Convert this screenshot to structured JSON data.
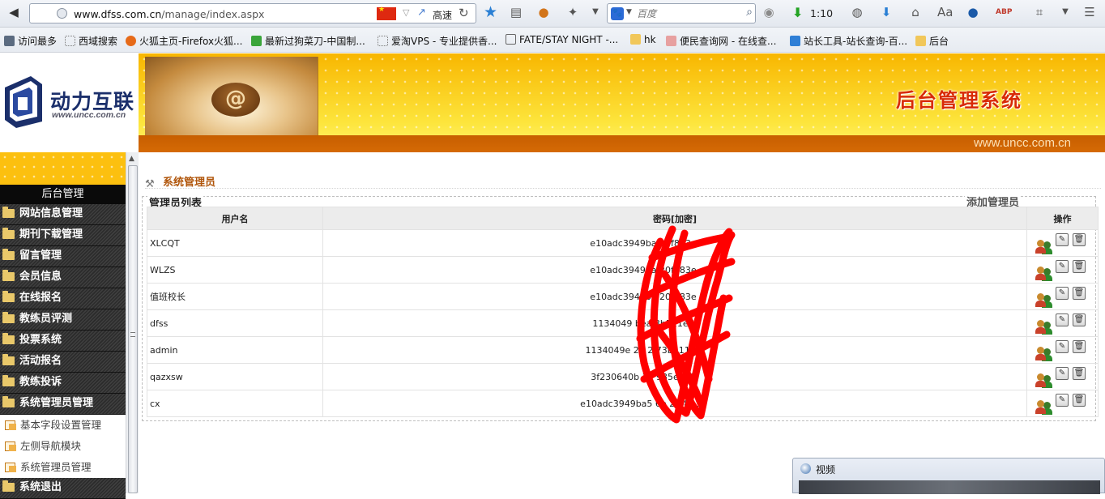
{
  "browser": {
    "url_host": "www.dfss.com.cn",
    "url_path": "/manage/index.aspx",
    "speed_label": "高速",
    "search_placeholder": "百度",
    "download_count": "1:10",
    "bookmarks": [
      {
        "label": "访问最多",
        "icon": "gear-icon",
        "color": "#5b6b80"
      },
      {
        "label": "西域搜索",
        "icon": "page-icon",
        "color": "#ffffff"
      },
      {
        "label": "火狐主页-Firefox火狐...",
        "icon": "firefox-icon",
        "color": "#e66a19"
      },
      {
        "label": "最新过狗菜刀-中国制...",
        "icon": "wifi-icon",
        "color": "#3aa53a"
      },
      {
        "label": "爱淘VPS - 专业提供香...",
        "icon": "page-icon",
        "color": "#ffffff"
      },
      {
        "label": "FATE/STAY NIGHT -...",
        "icon": "tv-icon",
        "color": "#666666"
      },
      {
        "label": "hk",
        "icon": "folder-icon",
        "color": "#f1c75a"
      },
      {
        "label": "便民查询网 - 在线查...",
        "icon": "rabbit-icon",
        "color": "#e7a0a0"
      },
      {
        "label": "站长工具-站长查询-百...",
        "icon": "tool-icon",
        "color": "#2f7fd6"
      },
      {
        "label": "后台",
        "icon": "folder-icon",
        "color": "#f1c75a"
      }
    ]
  },
  "header": {
    "logo_text": "动力互联",
    "logo_url": "www.uncc.com.cn",
    "title": "后台管理系统",
    "strip_url": "www.uncc.com.cn",
    "photo_glyph": "@"
  },
  "sidebar": {
    "title": "后台管理",
    "items": [
      {
        "label": "网站信息管理"
      },
      {
        "label": "期刊下载管理"
      },
      {
        "label": "留言管理"
      },
      {
        "label": "会员信息"
      },
      {
        "label": "在线报名"
      },
      {
        "label": "教练员评测"
      },
      {
        "label": "投票系统"
      },
      {
        "label": "活动报名"
      },
      {
        "label": "教练投诉"
      },
      {
        "label": "系统管理员管理"
      }
    ],
    "sub_items": [
      {
        "label": "基本字段设置管理"
      },
      {
        "label": "左侧导航模块"
      },
      {
        "label": "系统管理员管理"
      }
    ],
    "last_item": "系统退出"
  },
  "main": {
    "breadcrumb": "系统管理员",
    "panel_title": "管理员列表",
    "add_link": "添加管理员",
    "columns": [
      "用户名",
      "密码[加密]",
      "操作"
    ],
    "rows": [
      {
        "username": "XLCQT",
        "password": "e10adc3949ba            20f883e"
      },
      {
        "username": "WLZS",
        "password": "e10adc3949ba            20f883e"
      },
      {
        "username": "值班校长",
        "password": "e10adc3949ba            20f883e"
      },
      {
        "username": "dfss",
        "password": "1134049 bea             3b511e7"
      },
      {
        "username": "admin",
        "password": "1134049e       22 2     73b511e7"
      },
      {
        "username": "qazxsw",
        "password": "3f230640b         14    935eb69"
      },
      {
        "username": "cx",
        "password": "e10adc3949ba5        6e   20f883e"
      }
    ]
  },
  "video_window": {
    "title": "视频"
  },
  "colors": {
    "accent_orange": "#c75e00",
    "banner_yellow": "#fdd21a",
    "title_red": "#d82a06",
    "scribble_red": "#ff0000"
  }
}
